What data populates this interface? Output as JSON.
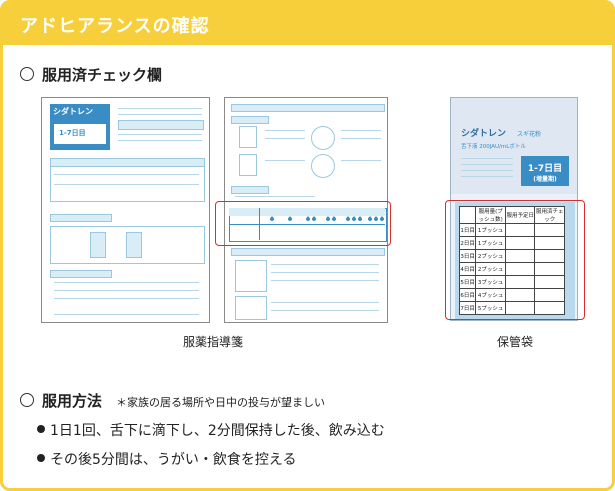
{
  "header": {
    "title": "アドヒアランスの確認"
  },
  "section1": {
    "title": "服用済チェック欄"
  },
  "figures": {
    "guide_caption": "服薬指導箋",
    "bag_caption": "保管袋"
  },
  "product": {
    "name": "シダトレン",
    "sub": "スギ花粉",
    "dose_line": "舌下液 200JAU/mLボトル",
    "period": "1-7日目",
    "period_note": "(増量期)"
  },
  "bag_table": {
    "headers": [
      "服用量(プッシュ数)",
      "服用予定日",
      "服用済チェック"
    ],
    "rows": [
      {
        "day": "1日目",
        "dose": "1プッシュ"
      },
      {
        "day": "2日目",
        "dose": "1プッシュ"
      },
      {
        "day": "3日目",
        "dose": "2プッシュ"
      },
      {
        "day": "4日目",
        "dose": "2プッシュ"
      },
      {
        "day": "5日目",
        "dose": "3プッシュ"
      },
      {
        "day": "6日目",
        "dose": "4プッシュ"
      },
      {
        "day": "7日目",
        "dose": "5プッシュ"
      }
    ]
  },
  "section2": {
    "title": "服用方法",
    "note": "＊家族の居る場所や日中の投与が望ましい",
    "bullets": [
      "1日1回、舌下に滴下し、2分間保持した後、飲み込む",
      "その後5分間は、うがい・飲食を控える"
    ]
  }
}
